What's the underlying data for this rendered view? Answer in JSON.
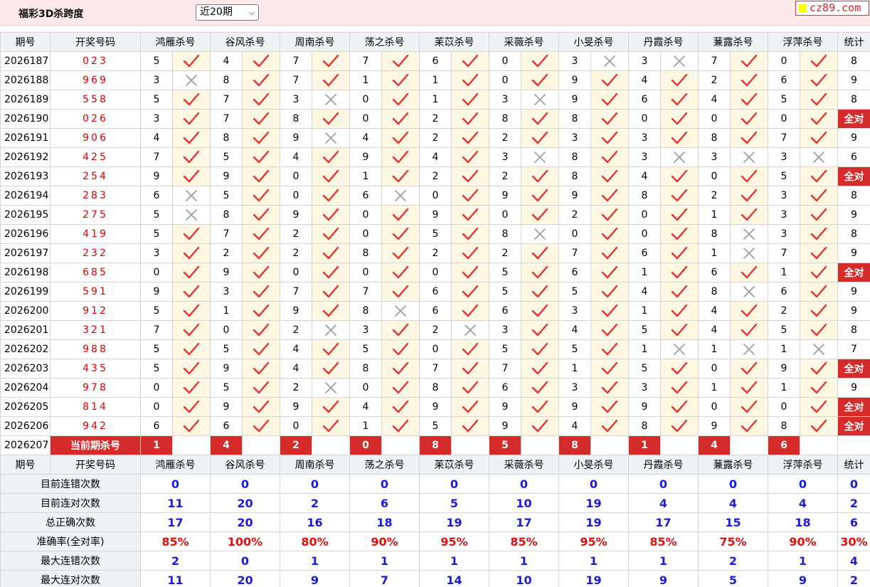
{
  "header": {
    "title": "福彩3D杀跨度",
    "period_selected": "近20期",
    "brand": "cz89.com"
  },
  "table": {
    "columns": {
      "issue": "期号",
      "draw": "开奖号码",
      "experts": [
        "鸿雁杀号",
        "谷风杀号",
        "周南杀号",
        "荡之杀号",
        "苿苡杀号",
        "采薇杀号",
        "小旻杀号",
        "丹霞杀号",
        "蒹露杀号",
        "浮萍杀号"
      ],
      "count": "统计"
    },
    "rows": [
      {
        "issue": "2026187",
        "draw": "023",
        "kills": [
          "5",
          "4",
          "7",
          "7",
          "6",
          "0",
          "3",
          "3",
          "7",
          "0"
        ],
        "results": [
          1,
          1,
          1,
          1,
          1,
          1,
          0,
          0,
          1,
          1
        ],
        "count": "8"
      },
      {
        "issue": "2026188",
        "draw": "969",
        "kills": [
          "3",
          "8",
          "7",
          "1",
          "1",
          "0",
          "9",
          "4",
          "2",
          "6"
        ],
        "results": [
          0,
          1,
          1,
          1,
          1,
          1,
          1,
          1,
          1,
          1
        ],
        "count": "9"
      },
      {
        "issue": "2026189",
        "draw": "558",
        "kills": [
          "5",
          "7",
          "3",
          "0",
          "1",
          "3",
          "9",
          "6",
          "4",
          "5"
        ],
        "results": [
          1,
          1,
          0,
          1,
          1,
          0,
          1,
          1,
          1,
          1
        ],
        "count": "8"
      },
      {
        "issue": "2026190",
        "draw": "026",
        "kills": [
          "3",
          "7",
          "8",
          "0",
          "2",
          "8",
          "8",
          "0",
          "0",
          "0"
        ],
        "results": [
          1,
          1,
          1,
          1,
          1,
          1,
          1,
          1,
          1,
          1
        ],
        "count": "全对"
      },
      {
        "issue": "2026191",
        "draw": "906",
        "kills": [
          "4",
          "8",
          "9",
          "4",
          "2",
          "2",
          "3",
          "3",
          "8",
          "7"
        ],
        "results": [
          1,
          1,
          0,
          1,
          1,
          1,
          1,
          1,
          1,
          1
        ],
        "count": "9"
      },
      {
        "issue": "2026192",
        "draw": "425",
        "kills": [
          "7",
          "5",
          "4",
          "9",
          "4",
          "3",
          "8",
          "3",
          "3",
          "3"
        ],
        "results": [
          1,
          1,
          1,
          1,
          1,
          0,
          1,
          0,
          0,
          0
        ],
        "count": "6"
      },
      {
        "issue": "2026193",
        "draw": "254",
        "kills": [
          "9",
          "9",
          "0",
          "1",
          "2",
          "2",
          "8",
          "4",
          "0",
          "5"
        ],
        "results": [
          1,
          1,
          1,
          1,
          1,
          1,
          1,
          1,
          1,
          1
        ],
        "count": "全对"
      },
      {
        "issue": "2026194",
        "draw": "283",
        "kills": [
          "6",
          "5",
          "0",
          "6",
          "0",
          "9",
          "9",
          "8",
          "2",
          "3"
        ],
        "results": [
          0,
          1,
          1,
          0,
          1,
          1,
          1,
          1,
          1,
          1
        ],
        "count": "8"
      },
      {
        "issue": "2026195",
        "draw": "275",
        "kills": [
          "5",
          "8",
          "9",
          "0",
          "9",
          "0",
          "2",
          "0",
          "1",
          "3"
        ],
        "results": [
          0,
          1,
          1,
          1,
          1,
          1,
          1,
          1,
          1,
          1
        ],
        "count": "9"
      },
      {
        "issue": "2026196",
        "draw": "419",
        "kills": [
          "5",
          "7",
          "2",
          "0",
          "5",
          "8",
          "0",
          "0",
          "8",
          "3"
        ],
        "results": [
          1,
          1,
          1,
          1,
          1,
          0,
          1,
          1,
          0,
          1
        ],
        "count": "8"
      },
      {
        "issue": "2026197",
        "draw": "232",
        "kills": [
          "3",
          "2",
          "2",
          "8",
          "2",
          "2",
          "7",
          "6",
          "1",
          "7"
        ],
        "results": [
          1,
          1,
          1,
          1,
          1,
          1,
          1,
          1,
          0,
          1
        ],
        "count": "9"
      },
      {
        "issue": "2026198",
        "draw": "685",
        "kills": [
          "0",
          "9",
          "0",
          "0",
          "0",
          "5",
          "6",
          "1",
          "6",
          "1"
        ],
        "results": [
          1,
          1,
          1,
          1,
          1,
          1,
          1,
          1,
          1,
          1
        ],
        "count": "全对"
      },
      {
        "issue": "2026199",
        "draw": "591",
        "kills": [
          "9",
          "3",
          "7",
          "7",
          "6",
          "5",
          "5",
          "4",
          "8",
          "6"
        ],
        "results": [
          1,
          1,
          1,
          1,
          1,
          1,
          1,
          1,
          0,
          1
        ],
        "count": "9"
      },
      {
        "issue": "2026200",
        "draw": "912",
        "kills": [
          "5",
          "1",
          "9",
          "8",
          "6",
          "6",
          "3",
          "1",
          "4",
          "2"
        ],
        "results": [
          1,
          1,
          1,
          0,
          1,
          1,
          1,
          1,
          1,
          1
        ],
        "count": "9"
      },
      {
        "issue": "2026201",
        "draw": "321",
        "kills": [
          "7",
          "0",
          "2",
          "3",
          "2",
          "3",
          "4",
          "5",
          "4",
          "5"
        ],
        "results": [
          1,
          1,
          0,
          1,
          0,
          1,
          1,
          1,
          1,
          1
        ],
        "count": "8"
      },
      {
        "issue": "2026202",
        "draw": "988",
        "kills": [
          "5",
          "5",
          "4",
          "5",
          "0",
          "5",
          "5",
          "1",
          "1",
          "1"
        ],
        "results": [
          1,
          1,
          1,
          1,
          1,
          1,
          1,
          0,
          0,
          0
        ],
        "count": "7"
      },
      {
        "issue": "2026203",
        "draw": "435",
        "kills": [
          "5",
          "9",
          "4",
          "8",
          "7",
          "7",
          "1",
          "5",
          "0",
          "9"
        ],
        "results": [
          1,
          1,
          1,
          1,
          1,
          1,
          1,
          1,
          1,
          1
        ],
        "count": "全对"
      },
      {
        "issue": "2026204",
        "draw": "978",
        "kills": [
          "0",
          "5",
          "2",
          "0",
          "8",
          "6",
          "3",
          "3",
          "1",
          "1"
        ],
        "results": [
          1,
          1,
          0,
          1,
          1,
          1,
          1,
          1,
          1,
          1
        ],
        "count": "9"
      },
      {
        "issue": "2026205",
        "draw": "814",
        "kills": [
          "0",
          "9",
          "9",
          "4",
          "9",
          "9",
          "9",
          "9",
          "0",
          "0"
        ],
        "results": [
          1,
          1,
          1,
          1,
          1,
          1,
          1,
          1,
          1,
          1
        ],
        "count": "全对"
      },
      {
        "issue": "2026206",
        "draw": "942",
        "kills": [
          "6",
          "6",
          "0",
          "1",
          "5",
          "9",
          "4",
          "8",
          "9",
          "8"
        ],
        "results": [
          1,
          1,
          1,
          1,
          1,
          1,
          1,
          1,
          1,
          1
        ],
        "count": "全对"
      }
    ],
    "current": {
      "issue": "2026207",
      "label": "当前期杀号",
      "kills": [
        "1",
        "4",
        "2",
        "0",
        "8",
        "5",
        "8",
        "1",
        "4",
        "6"
      ]
    },
    "stats": [
      {
        "label": "目前连错次数",
        "values": [
          "0",
          "0",
          "0",
          "0",
          "0",
          "0",
          "0",
          "0",
          "0",
          "0"
        ],
        "count": "0"
      },
      {
        "label": "目前连对次数",
        "values": [
          "11",
          "20",
          "2",
          "6",
          "5",
          "10",
          "19",
          "4",
          "4",
          "4"
        ],
        "count": "2"
      },
      {
        "label": "总正确次数",
        "values": [
          "17",
          "20",
          "16",
          "18",
          "19",
          "17",
          "19",
          "17",
          "15",
          "18"
        ],
        "count": "6"
      },
      {
        "label": "准确率(全对率)",
        "values": [
          "85%",
          "100%",
          "80%",
          "90%",
          "95%",
          "85%",
          "95%",
          "85%",
          "75%",
          "90%"
        ],
        "count": "30%"
      },
      {
        "label": "最大连错次数",
        "values": [
          "2",
          "0",
          "1",
          "1",
          "1",
          "1",
          "1",
          "1",
          "2",
          "1"
        ],
        "count": "4"
      },
      {
        "label": "最大连对次数",
        "values": [
          "11",
          "20",
          "9",
          "7",
          "14",
          "10",
          "19",
          "9",
          "5",
          "9"
        ],
        "count": "2"
      }
    ]
  },
  "icons": {
    "correct": "check-icon",
    "wrong": "cross-icon"
  },
  "colors": {
    "accent": "#d42b2b",
    "check": "#e83030",
    "cross": "#9a9a9a",
    "stat_value": "#1a1adf",
    "stat_rate": "#e01010"
  }
}
